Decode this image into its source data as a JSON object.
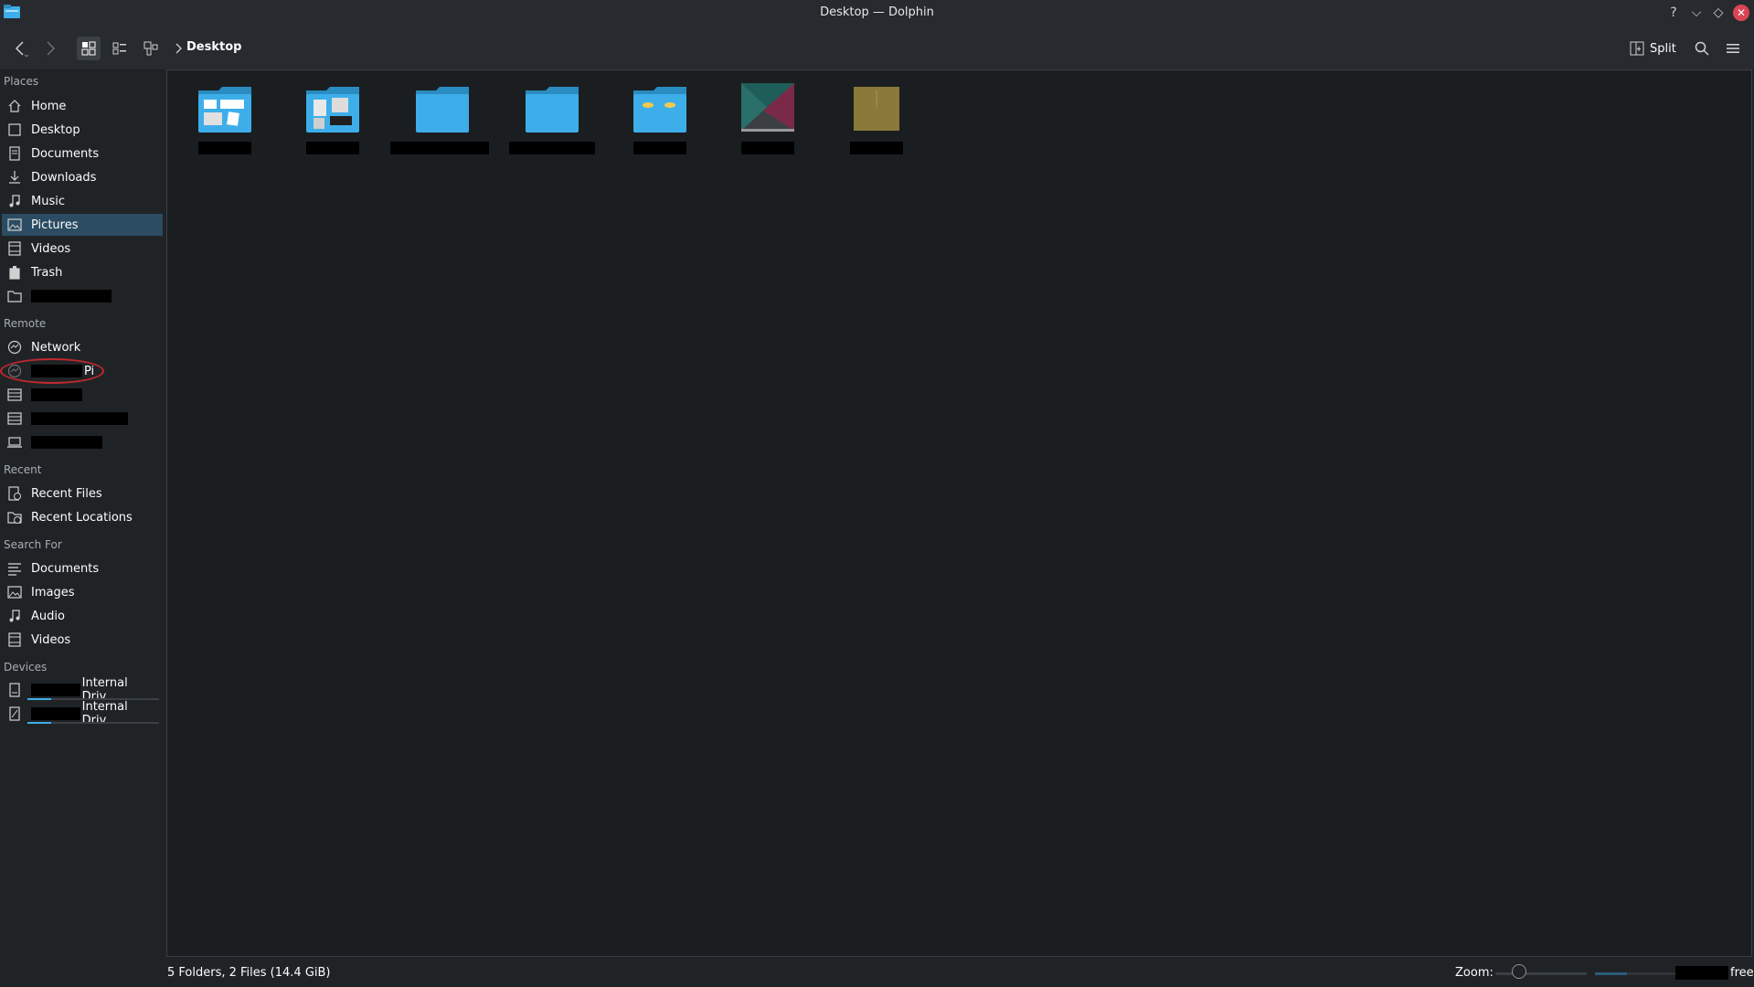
{
  "window": {
    "title": "Desktop — Dolphin",
    "controls": {
      "help": "?",
      "minimize": "⌵",
      "maximize": "◇",
      "close": "✕"
    }
  },
  "toolbar": {
    "breadcrumb": "Desktop",
    "split_label": "Split",
    "view_modes": [
      "icons-view",
      "details-view",
      "compact-view"
    ],
    "active_view": "icons-view"
  },
  "sidebar": {
    "places_title": "Places",
    "places": [
      {
        "label": "Home",
        "icon": "home-icon"
      },
      {
        "label": "Desktop",
        "icon": "desktop-icon"
      },
      {
        "label": "Documents",
        "icon": "documents-icon"
      },
      {
        "label": "Downloads",
        "icon": "downloads-icon"
      },
      {
        "label": "Music",
        "icon": "music-icon"
      },
      {
        "label": "Pictures",
        "icon": "pictures-icon",
        "selected": true
      },
      {
        "label": "Videos",
        "icon": "videos-icon"
      },
      {
        "label": "Trash",
        "icon": "trash-icon"
      },
      {
        "label": "",
        "icon": "folder-icon",
        "redacted": true
      }
    ],
    "remote_title": "Remote",
    "remote": [
      {
        "label": "Network",
        "icon": "network-icon"
      },
      {
        "label": "Pi",
        "icon": "network-share-icon",
        "redacted_prefix": true,
        "annotated": true
      },
      {
        "label": "",
        "icon": "server-icon",
        "redacted": true
      },
      {
        "label": "",
        "icon": "server-icon",
        "redacted": true
      },
      {
        "label": "",
        "icon": "laptop-icon",
        "redacted": true
      }
    ],
    "recent_title": "Recent",
    "recent": [
      {
        "label": "Recent Files",
        "icon": "recent-files-icon"
      },
      {
        "label": "Recent Locations",
        "icon": "recent-locations-icon"
      }
    ],
    "search_title": "Search For",
    "search": [
      {
        "label": "Documents",
        "icon": "text-documents-icon"
      },
      {
        "label": "Images",
        "icon": "images-icon"
      },
      {
        "label": "Audio",
        "icon": "audio-icon"
      },
      {
        "label": "Videos",
        "icon": "videos-icon"
      }
    ],
    "devices_title": "Devices",
    "devices": [
      {
        "label": "Internal Driv...",
        "icon": "drive-icon",
        "redacted_prefix": true,
        "usage": 0.18
      },
      {
        "label": "Internal Driv...",
        "icon": "drive-icon",
        "redacted_prefix": true,
        "usage": 0.18
      }
    ]
  },
  "files": [
    {
      "type": "folder",
      "icon": "folder-documents-icon"
    },
    {
      "type": "folder",
      "icon": "folder-pictures-icon"
    },
    {
      "type": "folder",
      "icon": "folder-icon"
    },
    {
      "type": "folder",
      "icon": "folder-icon"
    },
    {
      "type": "folder",
      "icon": "folder-special-icon"
    },
    {
      "type": "file",
      "icon": "image-file-icon"
    },
    {
      "type": "file",
      "icon": "document-file-icon"
    }
  ],
  "statusbar": {
    "summary": "5 Folders, 2 Files (14.4 GiB)",
    "zoom_label": "Zoom:",
    "free_label": "free",
    "zoom_level": 0.2,
    "space_used": 0.4
  },
  "colors": {
    "accent": "#3daee9",
    "selection": "#2b4c62",
    "folder": "#3daee9",
    "annotation": "#c0282d"
  }
}
